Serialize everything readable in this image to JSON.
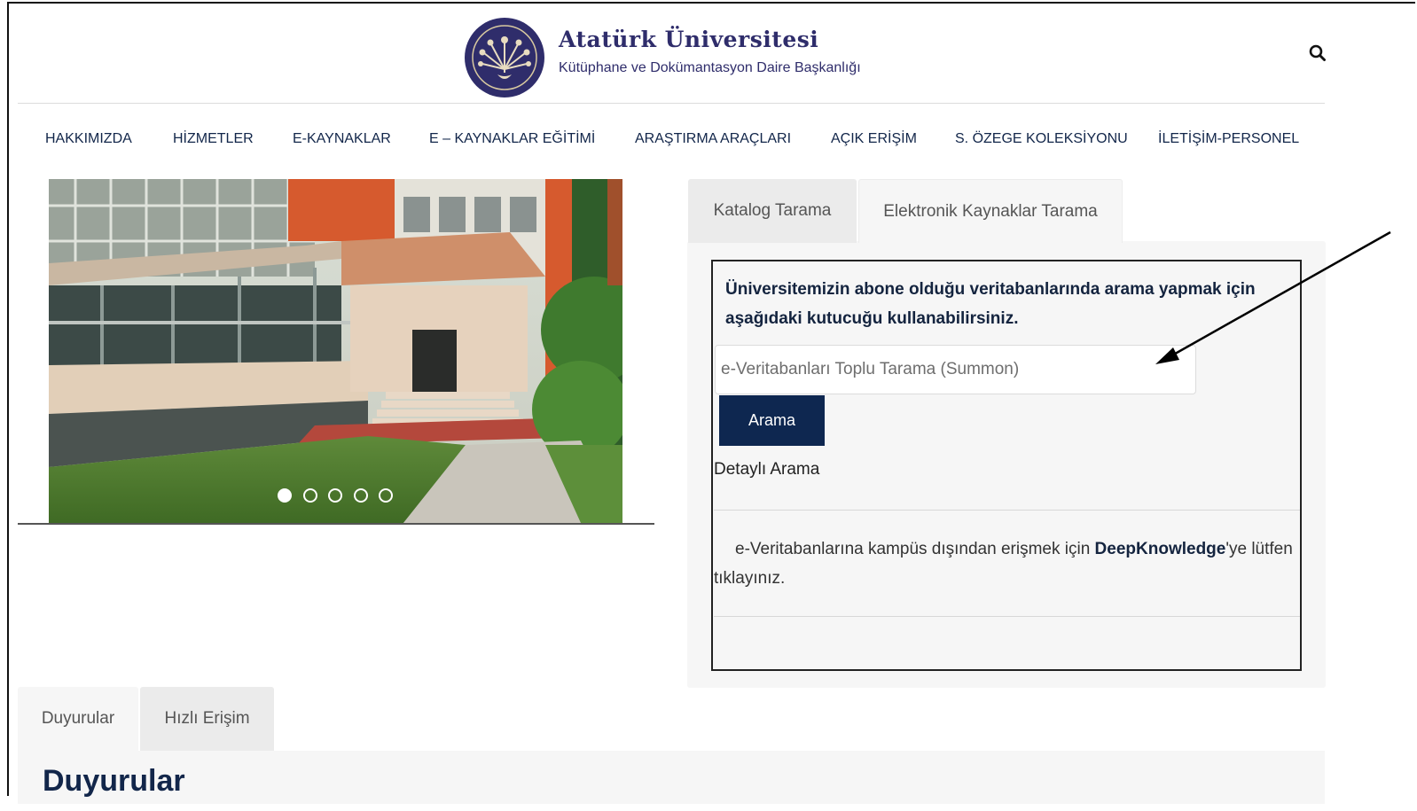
{
  "header": {
    "title": "Atatürk Üniversitesi",
    "subtitle": "Kütüphane ve Dokümantasyon Daire Başkanlığı",
    "logo_icon": "peacock-seal-logo",
    "search_icon": "search-icon"
  },
  "nav": {
    "items": [
      {
        "label": "HAKKIMIZDA"
      },
      {
        "label": "HİZMETLER"
      },
      {
        "label": "E-KAYNAKLAR"
      },
      {
        "label": "E – KAYNAKLAR EĞİTİMİ"
      },
      {
        "label": "ARAŞTIRMA ARAÇLARI"
      },
      {
        "label": "AÇIK ERİŞİM"
      },
      {
        "label": "S. ÖZEGE KOLEKSİYONU"
      },
      {
        "label": "İLETİŞİM-PERSONEL"
      }
    ]
  },
  "slider": {
    "active_index": 0,
    "dot_count": 5
  },
  "search_tabs": {
    "tabs": [
      {
        "label": "Katalog Tarama"
      },
      {
        "label": "Elektronik Kaynaklar Tarama"
      }
    ],
    "active_tab": "Elektronik Kaynaklar Tarama"
  },
  "search_box": {
    "heading": "Üniversitemizin abone olduğu veritabanlarında arama yapmak için aşağıdaki kutucuğu kullanabilirsiniz.",
    "input_placeholder": "e-Veritabanları Toplu Tarama (Summon)",
    "input_value": "",
    "button_label": "Arama",
    "detailed_link": "Detaylı Arama",
    "remote_text_before": "e-Veritabanlarına kampüs dışından erişmek için ",
    "remote_link": "DeepKnowledge",
    "remote_text_after": "'ye lütfen tıklayınız."
  },
  "bottom_tabs": {
    "tabs": [
      {
        "label": "Duyurular"
      },
      {
        "label": "Hızlı Erişim"
      }
    ],
    "active_tab": "Duyurular"
  },
  "news": {
    "heading": "Duyurular"
  },
  "colors": {
    "brand": "#2f2d6b",
    "nav_text": "#12264a",
    "button_bg": "#0e2750",
    "panel_bg": "#f6f6f6"
  }
}
